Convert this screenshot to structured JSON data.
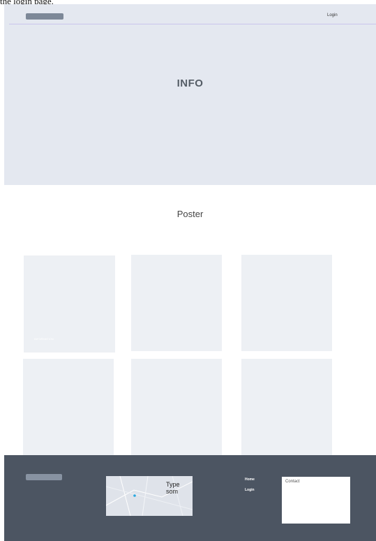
{
  "caption": "the login page.",
  "header": {
    "login_label": "Login"
  },
  "hero": {
    "title": "INFO"
  },
  "poster": {
    "title": "Poster",
    "cards": [
      {
        "label": "INFORMATION"
      },
      {
        "label": ""
      },
      {
        "label": ""
      },
      {
        "label": ""
      },
      {
        "label": ""
      },
      {
        "label": ""
      }
    ]
  },
  "footer": {
    "map_text": "Type som",
    "links": [
      "Home",
      "Login"
    ],
    "contact_label": "Contact"
  },
  "colors": {
    "hero_bg": "#e4e8f0",
    "footer_bg": "#4c5562",
    "card_bg": "#edf0f4",
    "logo_placeholder": "#7d8898",
    "map_marker": "#29a8e0"
  }
}
